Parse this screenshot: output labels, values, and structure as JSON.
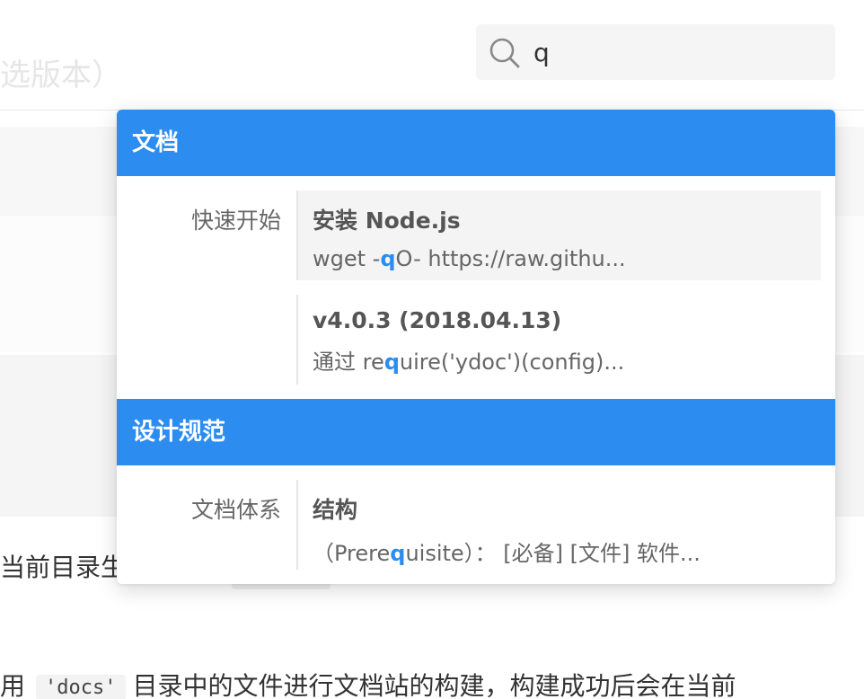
{
  "background": {
    "title_fragment": "选版本）",
    "line1": "当前目录生",
    "line2_prefix": "用",
    "line2_code": "'docs'",
    "line2_suffix": "目录中的文件进行文档站的构建，构建成功后会在当前"
  },
  "search": {
    "value": "q"
  },
  "dropdown": {
    "categories": [
      {
        "title": "文档",
        "groups": [
          {
            "subcategory": "快速开始",
            "results": [
              {
                "title": "安装 Node.js",
                "desc_pre": "wget -",
                "desc_hl": "q",
                "desc_post": "O- https://raw.githu..."
              },
              {
                "title": "v4.0.3 (2018.04.13)",
                "desc_pre": "通过 re",
                "desc_hl": "q",
                "desc_post": "uire('ydoc')(config)..."
              }
            ]
          }
        ]
      },
      {
        "title": "设计规范",
        "groups": [
          {
            "subcategory": "文档体系",
            "results": [
              {
                "title": "结构",
                "desc_pre": "（Prere",
                "desc_hl": "q",
                "desc_post": "uisite）： [必备] [文件] 软件..."
              }
            ]
          }
        ]
      }
    ]
  },
  "colors": {
    "accent": "#2d8cf0",
    "active_row": "#f4f4f4"
  },
  "icons": {
    "search": "search-icon"
  }
}
